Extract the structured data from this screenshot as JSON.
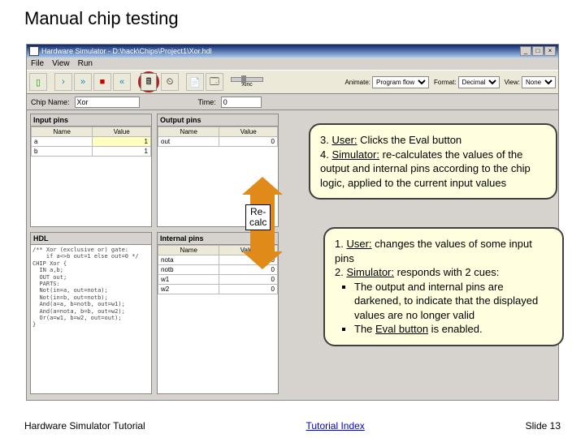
{
  "slide": {
    "title": "Manual chip testing",
    "footer_left": "Hardware Simulator Tutorial",
    "footer_center": "Tutorial Index",
    "footer_right": "Slide 13"
  },
  "app": {
    "title": "Hardware Simulator - D:\\hack\\Chips\\Project1\\Xor.hdl",
    "menu": {
      "file": "File",
      "view": "View",
      "run": "Run"
    },
    "toolbar": {
      "animate_label": "Animate:",
      "animate_value": "Program flow",
      "format_label": "Format:",
      "format_value": "Decimal",
      "view_label": "View:",
      "view_value": "None",
      "label_xinc": "Xinc"
    },
    "namebar": {
      "chip_label": "Chip Name:",
      "chip_value": "Xor",
      "time_label": "Time:",
      "time_value": "0"
    },
    "panels": {
      "input_title": "Input pins",
      "output_title": "Output pins",
      "internal_title": "Internal pins",
      "hdl_title": "HDL",
      "col_name": "Name",
      "col_value": "Value",
      "input_rows": [
        {
          "name": "a",
          "value": "1"
        },
        {
          "name": "b",
          "value": "1"
        }
      ],
      "output_rows": [
        {
          "name": "out",
          "value": "0"
        }
      ],
      "internal_rows": [
        {
          "name": "nota",
          "value": "0"
        },
        {
          "name": "notb",
          "value": "0"
        },
        {
          "name": "w1",
          "value": "0"
        },
        {
          "name": "w2",
          "value": "0"
        }
      ],
      "hdl_text": "/** Xor (exclusive or) gate:\n    if a<>b out=1 else out=0 */\nCHIP Xor {\n  IN a,b;\n  OUT out;\n  PARTS:\n  Not(in=a, out=nota);\n  Not(in=b, out=notb);\n  And(a=a, b=notb, out=w1);\n  And(a=nota, b=b, out=w2);\n  Or(a=w1, b=w2, out=out);\n}"
    }
  },
  "callouts": {
    "top": {
      "line3_a": "3. ",
      "line3_u": "User:",
      "line3_b": " Clicks the Eval button",
      "line4_a": "4. ",
      "line4_u": "Simulator:",
      "line4_b": " re-calculates the values of the output and internal pins according to the chip logic, applied to the current input values"
    },
    "bottom": {
      "line1_a": "1. ",
      "line1_u": "User:",
      "line1_b": " changes the values of some input pins",
      "line2_a": "2. ",
      "line2_u": "Simulator:",
      "line2_b": " responds with 2 cues:",
      "bullet1": "The output and internal pins are darkened, to indicate that the displayed values are no longer valid",
      "bullet2_a": "The ",
      "bullet2_u": "Eval button",
      "bullet2_b": " is enabled."
    },
    "recalc": "Re-\ncalc"
  }
}
